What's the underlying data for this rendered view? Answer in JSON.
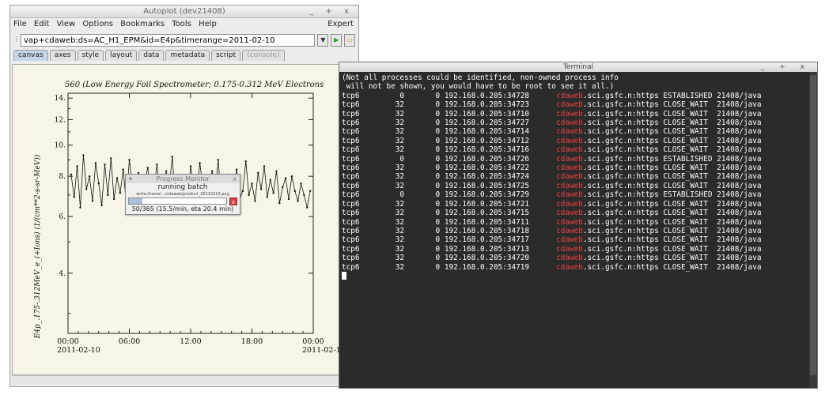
{
  "autoplot": {
    "title": "Autoplot (dev21408)",
    "window_buttons": "_ + x",
    "menus": [
      "File",
      "Edit",
      "View",
      "Options",
      "Bookmarks",
      "Tools",
      "Help"
    ],
    "expert_label": "Expert",
    "url_value": "vap+cdaweb:ds=AC_H1_EPM&id=E4p&timerange=2011-02-10",
    "tabs": [
      {
        "label": "canvas",
        "active": true
      },
      {
        "label": "axes"
      },
      {
        "label": "style"
      },
      {
        "label": "layout"
      },
      {
        "label": "data"
      },
      {
        "label": "metadata"
      },
      {
        "label": "script"
      },
      {
        "label": "(console)",
        "disabled": true
      }
    ]
  },
  "plot": {
    "title": "560 (Low Energy Foil Spectrometer; 0.175-0.312 MeV Electrons",
    "ylabel": "E4p_.175-.312MeV_e_(+Ions) (1/(cm**2-s-sr-MeV))",
    "yticks": [
      "14.",
      "12.",
      "10.",
      "8.",
      "6.",
      "4."
    ],
    "xticks": [
      "00:00",
      "06:00",
      "12:00",
      "18:00",
      "00:00"
    ],
    "xdates": [
      "2011-02-10",
      "2011-02-1"
    ]
  },
  "chart_data": {
    "type": "line",
    "title": "560 (Low Energy Foil Spectrometer; 0.175-0.312 MeV Electrons",
    "ylabel": "E4p_.175-.312MeV_e_(+Ions) (1/(cm**2-s-sr-MeV))",
    "xlabel": "",
    "yscale": "log",
    "ylim": [
      2.6,
      14.5
    ],
    "xlim": [
      0,
      24
    ],
    "grid": false,
    "series": [
      {
        "x": [
          0.3,
          0.6,
          0.9,
          1.2,
          1.5,
          1.8,
          2.1,
          2.4,
          2.7,
          3.0,
          3.3,
          3.6,
          3.9,
          4.2,
          4.5,
          4.8,
          5.1,
          5.4,
          5.7,
          6.0,
          6.3,
          6.6,
          6.9,
          7.2,
          7.5,
          7.8,
          8.1,
          8.4,
          8.7,
          9.0,
          9.3,
          9.6,
          9.9,
          10.2,
          10.5,
          10.8,
          11.1,
          11.4,
          11.7,
          12.0,
          12.3,
          12.6,
          12.9,
          13.2,
          13.5,
          13.8,
          14.1,
          14.4,
          14.7,
          15.0,
          15.3,
          15.6,
          15.9,
          16.2,
          16.5,
          16.8,
          17.1,
          17.4,
          17.7,
          18.0,
          18.3,
          18.6,
          18.9,
          19.2,
          19.5,
          19.8,
          20.1,
          20.4,
          20.7,
          21.0,
          21.3,
          21.6,
          21.9,
          22.2,
          22.5,
          22.8,
          23.1,
          23.4,
          23.7
        ],
        "values": [
          8.1,
          6.9,
          8.6,
          6.4,
          9.3,
          7.3,
          8.0,
          6.7,
          8.8,
          7.6,
          6.5,
          8.7,
          7.0,
          9.1,
          6.8,
          7.9,
          7.1,
          8.4,
          6.6,
          9.0,
          7.5,
          7.0,
          8.2,
          6.7,
          7.7,
          8.5,
          6.9,
          7.3,
          8.7,
          7.1,
          6.6,
          8.3,
          7.4,
          9.2,
          6.8,
          7.8,
          7.2,
          8.0,
          6.5,
          8.6,
          7.3,
          6.9,
          8.8,
          7.4,
          7.9,
          6.7,
          8.3,
          7.2,
          9.0,
          6.6,
          7.7,
          8.1,
          6.9,
          7.5,
          8.4,
          6.8,
          7.2,
          8.9,
          7.0,
          7.6,
          6.7,
          8.2,
          7.3,
          8.6,
          6.9,
          7.8,
          7.1,
          8.3,
          6.6,
          7.4,
          7.9,
          6.8,
          8.0,
          7.2,
          6.7,
          7.6,
          7.0,
          6.4,
          7.2
        ]
      }
    ]
  },
  "progress": {
    "title": "Progress Monitor",
    "message": "running batch",
    "sub": "write:/home/.../cdaweb/product_20110210.png",
    "info": "50/365 (15.5/min, eta 20.4 min)",
    "fraction": 0.137,
    "close": "x",
    "cancel": "x"
  },
  "terminal": {
    "title": "Terminal",
    "window_buttons": "_ + x",
    "header": [
      "(Not all processes could be identified, non-owned process info",
      " will not be shown, you would have to be root to see it all.)"
    ],
    "rows": [
      {
        "proto": "tcp6",
        "recv": "0",
        "send": "0",
        "local": "192.168.0.205:34728",
        "host": "cdaweb",
        "rest": ".sci.gsfc.n:https",
        "state": "ESTABLISHED",
        "pid": "21408/java"
      },
      {
        "proto": "tcp6",
        "recv": "32",
        "send": "0",
        "local": "192.168.0.205:34723",
        "host": "cdaweb",
        "rest": ".sci.gsfc.n:https",
        "state": "CLOSE_WAIT",
        "pid": "21408/java"
      },
      {
        "proto": "tcp6",
        "recv": "32",
        "send": "0",
        "local": "192.168.0.205:34710",
        "host": "cdaweb",
        "rest": ".sci.gsfc.n:https",
        "state": "CLOSE_WAIT",
        "pid": "21408/java"
      },
      {
        "proto": "tcp6",
        "recv": "32",
        "send": "0",
        "local": "192.168.0.205:34727",
        "host": "cdaweb",
        "rest": ".sci.gsfc.n:https",
        "state": "CLOSE_WAIT",
        "pid": "21408/java"
      },
      {
        "proto": "tcp6",
        "recv": "32",
        "send": "0",
        "local": "192.168.0.205:34714",
        "host": "cdaweb",
        "rest": ".sci.gsfc.n:https",
        "state": "CLOSE_WAIT",
        "pid": "21408/java"
      },
      {
        "proto": "tcp6",
        "recv": "32",
        "send": "0",
        "local": "192.168.0.205:34712",
        "host": "cdaweb",
        "rest": ".sci.gsfc.n:https",
        "state": "CLOSE_WAIT",
        "pid": "21408/java"
      },
      {
        "proto": "tcp6",
        "recv": "32",
        "send": "0",
        "local": "192.168.0.205:34716",
        "host": "cdaweb",
        "rest": ".sci.gsfc.n:https",
        "state": "CLOSE_WAIT",
        "pid": "21408/java"
      },
      {
        "proto": "tcp6",
        "recv": "0",
        "send": "0",
        "local": "192.168.0.205:34726",
        "host": "cdaweb",
        "rest": ".sci.gsfc.n:https",
        "state": "ESTABLISHED",
        "pid": "21408/java"
      },
      {
        "proto": "tcp6",
        "recv": "32",
        "send": "0",
        "local": "192.168.0.205:34722",
        "host": "cdaweb",
        "rest": ".sci.gsfc.n:https",
        "state": "CLOSE_WAIT",
        "pid": "21408/java"
      },
      {
        "proto": "tcp6",
        "recv": "32",
        "send": "0",
        "local": "192.168.0.205:34724",
        "host": "cdaweb",
        "rest": ".sci.gsfc.n:https",
        "state": "CLOSE_WAIT",
        "pid": "21408/java"
      },
      {
        "proto": "tcp6",
        "recv": "32",
        "send": "0",
        "local": "192.168.0.205:34725",
        "host": "cdaweb",
        "rest": ".sci.gsfc.n:https",
        "state": "CLOSE_WAIT",
        "pid": "21408/java"
      },
      {
        "proto": "tcp6",
        "recv": "0",
        "send": "0",
        "local": "192.168.0.205:34729",
        "host": "cdaweb",
        "rest": ".sci.gsfc.n:https",
        "state": "ESTABLISHED",
        "pid": "21408/java"
      },
      {
        "proto": "tcp6",
        "recv": "32",
        "send": "0",
        "local": "192.168.0.205:34721",
        "host": "cdaweb",
        "rest": ".sci.gsfc.n:https",
        "state": "CLOSE_WAIT",
        "pid": "21408/java"
      },
      {
        "proto": "tcp6",
        "recv": "32",
        "send": "0",
        "local": "192.168.0.205:34715",
        "host": "cdaweb",
        "rest": ".sci.gsfc.n:https",
        "state": "CLOSE_WAIT",
        "pid": "21408/java"
      },
      {
        "proto": "tcp6",
        "recv": "32",
        "send": "0",
        "local": "192.168.0.205:34711",
        "host": "cdaweb",
        "rest": ".sci.gsfc.n:https",
        "state": "CLOSE_WAIT",
        "pid": "21408/java"
      },
      {
        "proto": "tcp6",
        "recv": "32",
        "send": "0",
        "local": "192.168.0.205:34718",
        "host": "cdaweb",
        "rest": ".sci.gsfc.n:https",
        "state": "CLOSE_WAIT",
        "pid": "21408/java"
      },
      {
        "proto": "tcp6",
        "recv": "32",
        "send": "0",
        "local": "192.168.0.205:34717",
        "host": "cdaweb",
        "rest": ".sci.gsfc.n:https",
        "state": "CLOSE_WAIT",
        "pid": "21408/java"
      },
      {
        "proto": "tcp6",
        "recv": "32",
        "send": "0",
        "local": "192.168.0.205:34713",
        "host": "cdaweb",
        "rest": ".sci.gsfc.n:https",
        "state": "CLOSE_WAIT",
        "pid": "21408/java"
      },
      {
        "proto": "tcp6",
        "recv": "32",
        "send": "0",
        "local": "192.168.0.205:34720",
        "host": "cdaweb",
        "rest": ".sci.gsfc.n:https",
        "state": "CLOSE_WAIT",
        "pid": "21408/java"
      },
      {
        "proto": "tcp6",
        "recv": "32",
        "send": "0",
        "local": "192.168.0.205:34719",
        "host": "cdaweb",
        "rest": ".sci.gsfc.n:https",
        "state": "CLOSE_WAIT",
        "pid": "21408/java"
      }
    ]
  },
  "colors": {
    "terminal_bg": "#2b2b2b",
    "host_red": "#e74040",
    "canvas_bg": "#f8f4e6"
  }
}
